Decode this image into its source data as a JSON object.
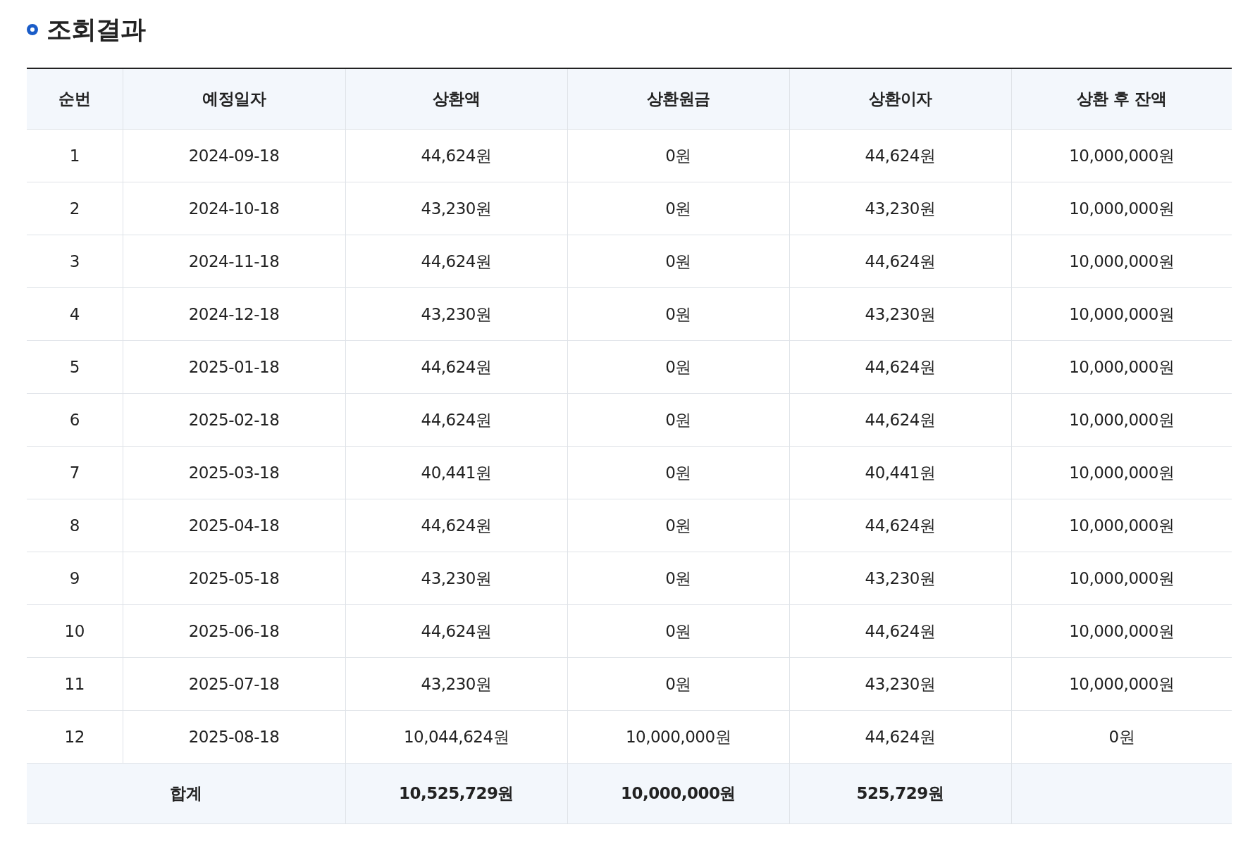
{
  "title": "조회결과",
  "table": {
    "columns": [
      "순번",
      "예정일자",
      "상환액",
      "상환원금",
      "상환이자",
      "상환 후 잔액"
    ],
    "rows": [
      [
        "1",
        "2024-09-18",
        "44,624원",
        "0원",
        "44,624원",
        "10,000,000원"
      ],
      [
        "2",
        "2024-10-18",
        "43,230원",
        "0원",
        "43,230원",
        "10,000,000원"
      ],
      [
        "3",
        "2024-11-18",
        "44,624원",
        "0원",
        "44,624원",
        "10,000,000원"
      ],
      [
        "4",
        "2024-12-18",
        "43,230원",
        "0원",
        "43,230원",
        "10,000,000원"
      ],
      [
        "5",
        "2025-01-18",
        "44,624원",
        "0원",
        "44,624원",
        "10,000,000원"
      ],
      [
        "6",
        "2025-02-18",
        "44,624원",
        "0원",
        "44,624원",
        "10,000,000원"
      ],
      [
        "7",
        "2025-03-18",
        "40,441원",
        "0원",
        "40,441원",
        "10,000,000원"
      ],
      [
        "8",
        "2025-04-18",
        "44,624원",
        "0원",
        "44,624원",
        "10,000,000원"
      ],
      [
        "9",
        "2025-05-18",
        "43,230원",
        "0원",
        "43,230원",
        "10,000,000원"
      ],
      [
        "10",
        "2025-06-18",
        "44,624원",
        "0원",
        "44,624원",
        "10,000,000원"
      ],
      [
        "11",
        "2025-07-18",
        "43,230원",
        "0원",
        "43,230원",
        "10,000,000원"
      ],
      [
        "12",
        "2025-08-18",
        "10,044,624원",
        "10,000,000원",
        "44,624원",
        "0원"
      ]
    ],
    "total": {
      "label": "합계",
      "values": [
        "10,525,729원",
        "10,000,000원",
        "525,729원"
      ]
    }
  }
}
